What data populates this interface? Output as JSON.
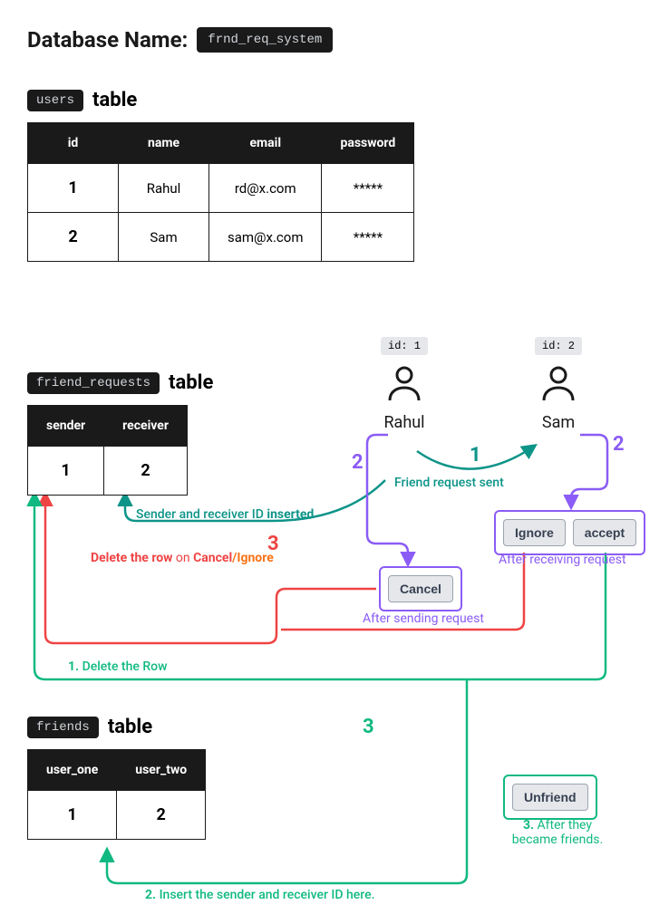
{
  "header": {
    "title": "Database Name:",
    "db_name": "frnd_req_system"
  },
  "tables": {
    "users": {
      "name": "users",
      "label": "table",
      "columns": [
        "id",
        "name",
        "email",
        "password"
      ],
      "rows": [
        {
          "id": "1",
          "name": "Rahul",
          "email": "rd@x.com",
          "password": "*****"
        },
        {
          "id": "2",
          "name": "Sam",
          "email": "sam@x.com",
          "password": "*****"
        }
      ]
    },
    "friend_requests": {
      "name": "friend_requests",
      "label": "table",
      "columns": [
        "sender",
        "receiver"
      ],
      "rows": [
        {
          "sender": "1",
          "receiver": "2"
        }
      ]
    },
    "friends": {
      "name": "friends",
      "label": "table",
      "columns": [
        "user_one",
        "user_two"
      ],
      "rows": [
        {
          "user_one": "1",
          "user_two": "2"
        }
      ]
    }
  },
  "users": {
    "u1": {
      "id_label": "id: 1",
      "name": "Rahul"
    },
    "u2": {
      "id_label": "id: 2",
      "name": "Sam"
    }
  },
  "actions": {
    "cancel": "Cancel",
    "ignore": "Ignore",
    "accept": "accept",
    "unfriend": "Unfriend"
  },
  "captions": {
    "after_sending": "After sending request",
    "after_receiving": "After receiving request",
    "after_friends_prefix": "3. ",
    "after_friends": "After they became friends."
  },
  "steps": {
    "one": "1",
    "two_left": "2",
    "two_right": "2",
    "three_red": "3",
    "three_green": "3"
  },
  "annotations": {
    "friend_sent": "Friend request sent",
    "insert_ids_prefix": "Sender and receiver ID ",
    "insert_ids_bold": "inserted",
    "delete_row_prefix": "Delete the row",
    "delete_row_mid": " on ",
    "delete_row_cancel": "Cancel",
    "delete_row_slash": "/",
    "delete_row_ignore": "Ignore",
    "green_delete_prefix": "1. ",
    "green_delete": "Delete the Row",
    "green_insert_prefix": "2. ",
    "green_insert": "Insert the sender and receiver ID here."
  }
}
